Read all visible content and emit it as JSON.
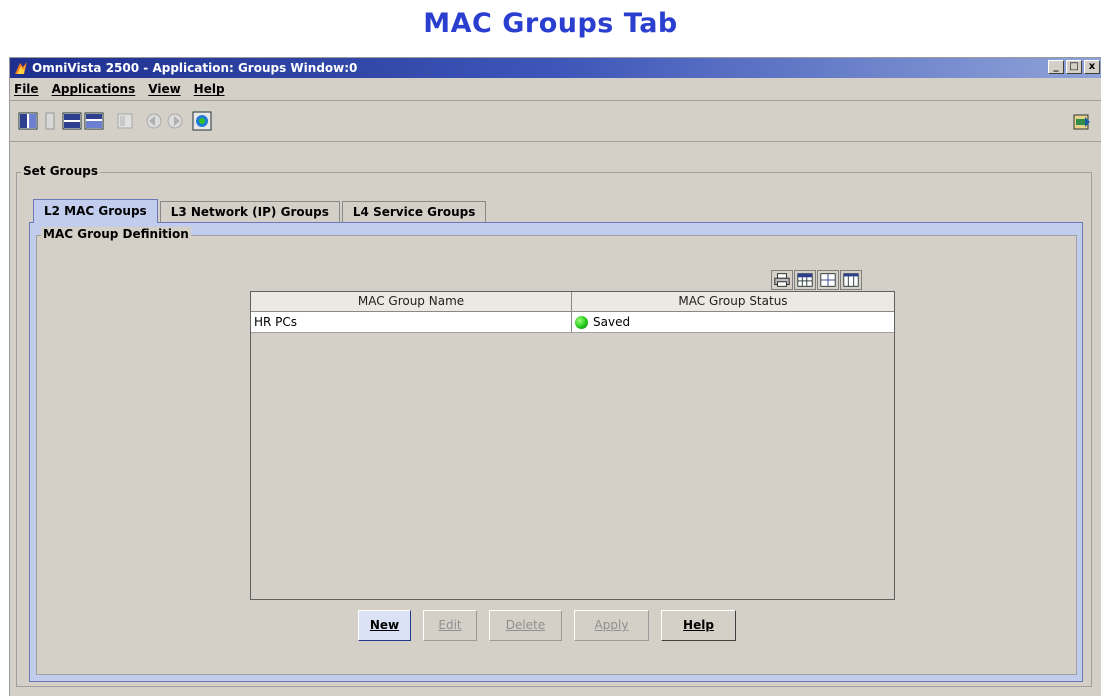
{
  "banner": {
    "title": "MAC Groups Tab"
  },
  "window": {
    "title": "OmniVista 2500 -  Application: Groups  Window:0",
    "controls": {
      "minimize": "_",
      "maximize": "□",
      "close": "x"
    }
  },
  "menubar": {
    "items": [
      "File",
      "Applications",
      "View",
      "Help"
    ]
  },
  "toolbar": {
    "icons": [
      "layout-columns-icon",
      "layout-single-column-icon",
      "layout-rows-icon",
      "layout-rows-alt-icon",
      "panel-icon",
      "back-icon",
      "forward-icon",
      "refresh-icon"
    ],
    "right_icon": "exit-icon"
  },
  "set_groups": {
    "title": "Set Groups",
    "tabs": [
      {
        "label": "L2 MAC Groups",
        "active": true
      },
      {
        "label": "L3 Network (IP) Groups",
        "active": false
      },
      {
        "label": "L4 Service Groups",
        "active": false
      }
    ],
    "panel": {
      "title": "MAC Group Definition",
      "table_tools": [
        "print-icon",
        "table-settings-icon",
        "grid-icon",
        "columns-icon"
      ],
      "table": {
        "columns": [
          "MAC Group Name",
          "MAC Group Status"
        ],
        "rows": [
          {
            "name": "HR PCs",
            "status": "Saved",
            "status_color": "#22c81a"
          }
        ]
      },
      "buttons": [
        {
          "label": "New",
          "enabled": true
        },
        {
          "label": "Edit",
          "enabled": false
        },
        {
          "label": "Delete",
          "enabled": false
        },
        {
          "label": "Apply",
          "enabled": false
        },
        {
          "label": "Help",
          "enabled": true
        }
      ]
    }
  }
}
